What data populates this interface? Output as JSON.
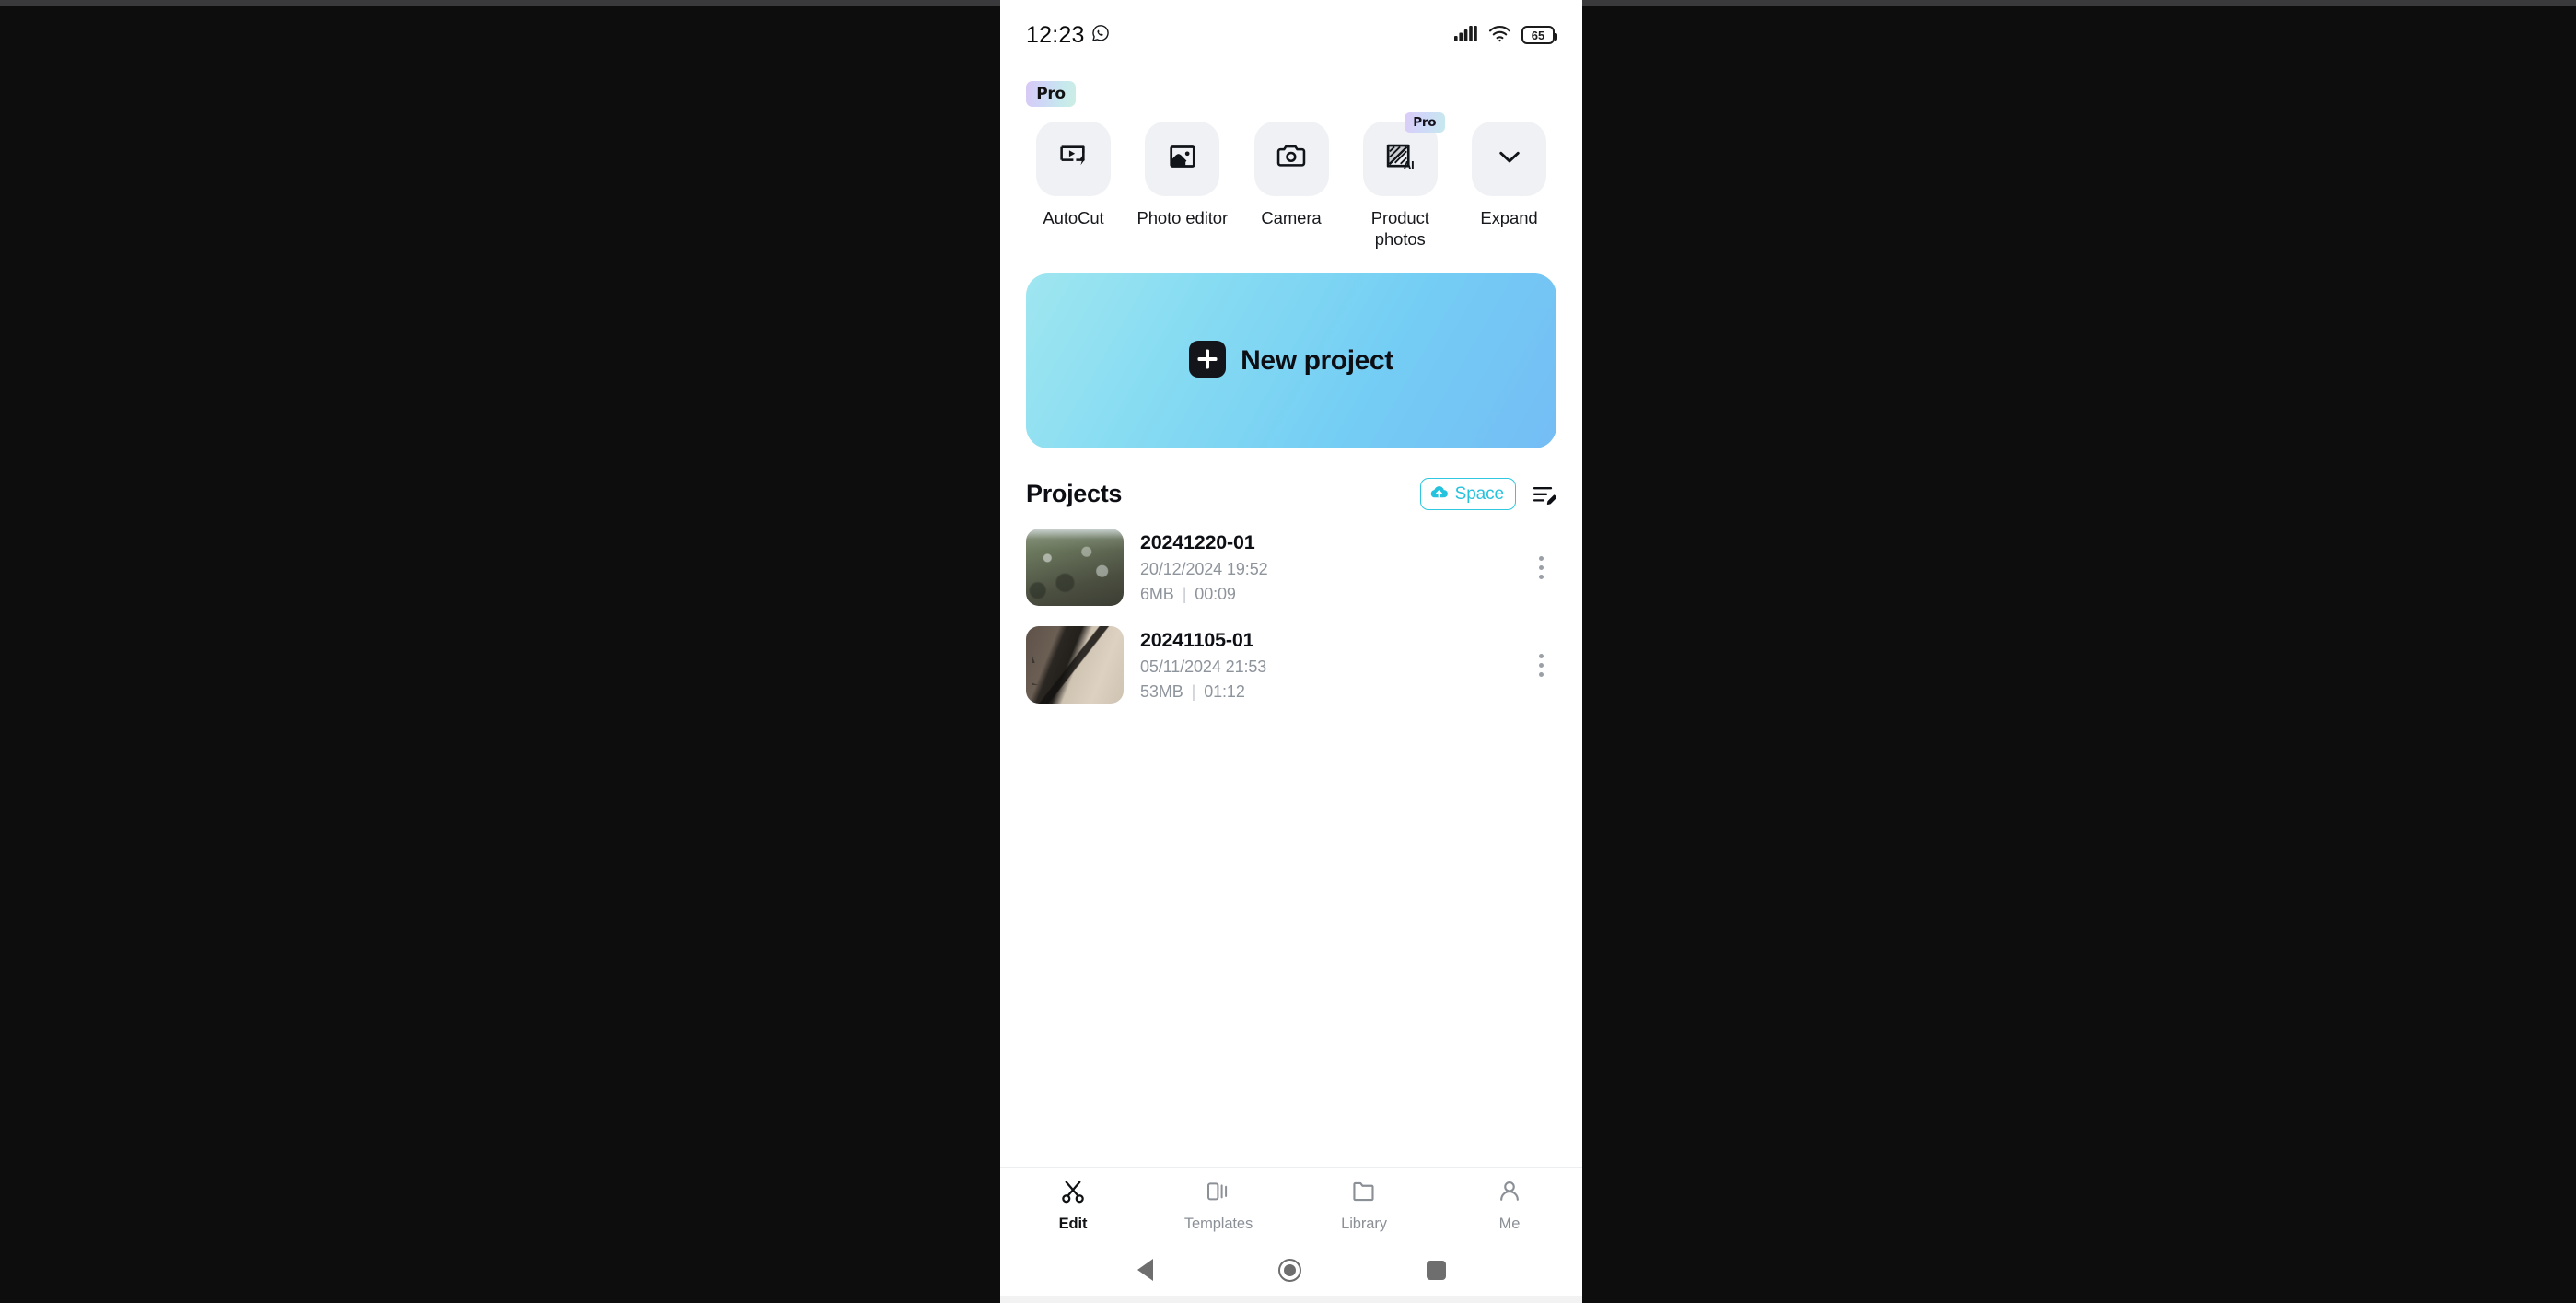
{
  "statusbar": {
    "time": "12:23",
    "messaging_icon": "whatsapp-icon",
    "signal_icon": "cellular-signal-icon",
    "wifi_icon": "wifi-icon",
    "battery_level": "65"
  },
  "header": {
    "pro_badge": "Pro"
  },
  "quick_actions": [
    {
      "label": "AutoCut",
      "icon": "autocut-icon",
      "pro": false
    },
    {
      "label": "Photo editor",
      "icon": "photo-editor-icon",
      "pro": false
    },
    {
      "label": "Camera",
      "icon": "camera-icon",
      "pro": false
    },
    {
      "label": "Product photos",
      "icon": "product-photos-ai-icon",
      "pro": true,
      "pro_label": "Pro"
    },
    {
      "label": "Expand",
      "icon": "chevron-down-icon",
      "pro": false
    }
  ],
  "new_project": {
    "label": "New project",
    "icon": "plus-icon",
    "gradient_from": "#9fe6f0",
    "gradient_to": "#74bdf5"
  },
  "projects_section": {
    "title": "Projects",
    "space_button": {
      "label": "Space",
      "icon": "cloud-upload-icon",
      "color": "#25c2dd"
    },
    "manage_icon": "list-edit-icon",
    "items": [
      {
        "name": "20241220-01",
        "date": "20/12/2024 19:52",
        "size": "6MB",
        "separator": "|",
        "duration": "00:09",
        "thumbnail": "hillside-village-thumbnail"
      },
      {
        "name": "20241105-01",
        "date": "05/11/2024 21:53",
        "size": "53MB",
        "separator": "|",
        "duration": "01:12",
        "thumbnail": "cracked-pavement-thumbnail"
      }
    ]
  },
  "tabbar": {
    "active": "Edit",
    "items": [
      {
        "label": "Edit",
        "icon": "scissors-icon",
        "active": true
      },
      {
        "label": "Templates",
        "icon": "templates-cards-icon",
        "active": false
      },
      {
        "label": "Library",
        "icon": "folder-icon",
        "active": false
      },
      {
        "label": "Me",
        "icon": "person-icon",
        "active": false
      }
    ]
  },
  "android_nav": {
    "back": "back-triangle-icon",
    "home": "home-circle-icon",
    "recents": "recents-square-icon"
  }
}
